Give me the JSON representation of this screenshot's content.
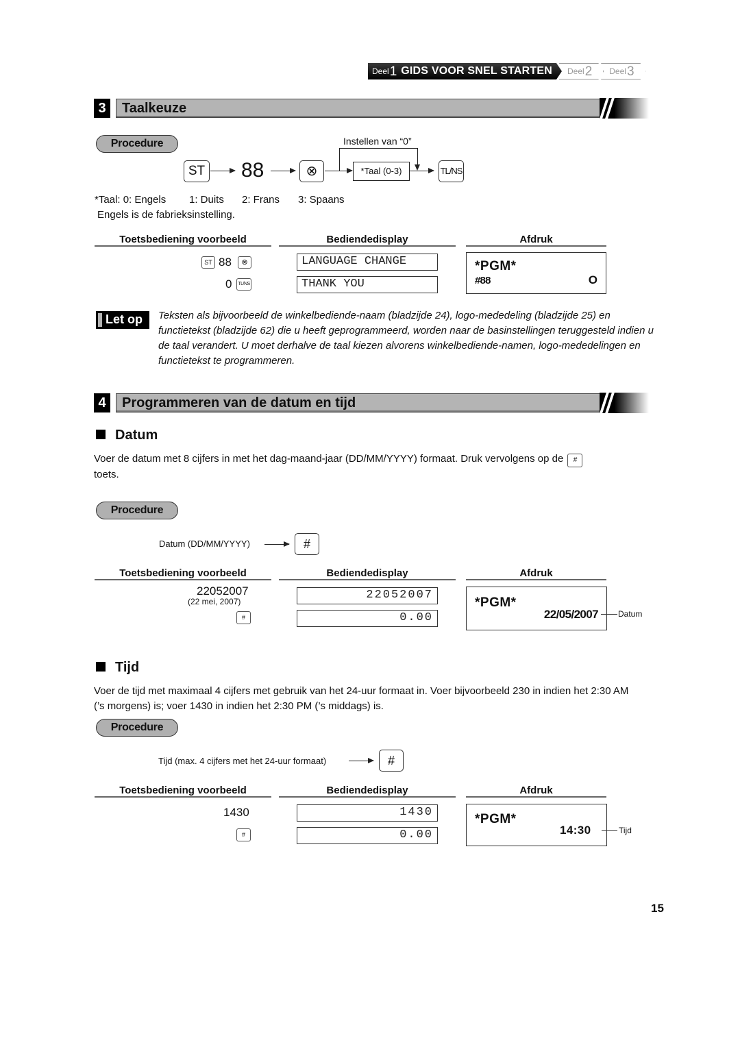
{
  "breadcrumb": {
    "active": {
      "prefix": "Deel",
      "number": "1",
      "title": "GIDS VOOR SNEL STARTEN"
    },
    "items": [
      {
        "prefix": "Deel",
        "number": "2"
      },
      {
        "prefix": "Deel",
        "number": "3"
      }
    ]
  },
  "section3": {
    "number": "3",
    "title": "Taalkeuze",
    "procedure_label": "Procedure",
    "flow": {
      "key_st": "ST",
      "code": "88",
      "key_multiply": "⊗",
      "bypass_label": "Instellen van “0”",
      "taal_box": "*Taal (0-3)",
      "key_tlns": "TL/NS"
    },
    "language_options": [
      "*Taal: 0: Engels",
      "1: Duits",
      "2: Frans",
      "3: Spaans"
    ],
    "default_note": "Engels is de fabrieksinstelling.",
    "columns": {
      "keys": "Toetsbediening voorbeeld",
      "display": "Bediendedisplay",
      "print": "Afdruk"
    },
    "example": {
      "key_row1": {
        "key_st": "ST",
        "code": "88",
        "key_multiply": "⊗"
      },
      "key_row2": {
        "value": "0",
        "key_tlns": "TL/NS"
      },
      "display_row1": "LANGUAGE CHANGE",
      "display_row2": "THANK YOU",
      "print_header": "*PGM*",
      "print_line_left": "#88",
      "print_line_right": "O"
    },
    "note_badge": "Let op",
    "note_text": "Teksten als bijvoorbeeld de winkelbediende-naam (bladzijde 24), logo-mededeling (bladzijde 25) en functietekst (bladzijde 62) die u heeft geprogrammeerd, worden naar de basinstellingen teruggesteld indien u de taal verandert. U moet derhalve de taal kiezen alvorens winkelbediende-namen, logo-mededelingen en functietekst te programmeren."
  },
  "section4": {
    "number": "4",
    "title": "Programmeren van de datum en tijd",
    "datum": {
      "heading": "Datum",
      "description_before": "Voer de datum met 8 cijfers in met het dag-maand-jaar (DD/MM/YYYY) formaat. Druk vervolgens op de",
      "description_key": "#",
      "description_after": "toets.",
      "procedure_label": "Procedure",
      "flow_label": "Datum (DD/MM/YYYY)",
      "flow_key": "#",
      "columns": {
        "keys": "Toetsbediening voorbeeld",
        "display": "Bediendedisplay",
        "print": "Afdruk"
      },
      "example": {
        "key_value": "22052007",
        "key_note": "(22 mei, 2007)",
        "key_hash": "#",
        "display_row1": "22052007",
        "display_row2": "0.00",
        "print_header": "*PGM*",
        "print_value": "22/05/2007",
        "print_callout": "Datum"
      }
    },
    "tijd": {
      "heading": "Tijd",
      "description": "Voer de tijd met maximaal 4 cijfers met gebruik van het 24-uur formaat in. Voer bijvoorbeeld 230 in indien het 2:30 AM (’s morgens) is; voer 1430 in indien het 2:30 PM (’s middags) is.",
      "procedure_label": "Procedure",
      "flow_label": "Tijd (max. 4 cijfers met het 24-uur formaat)",
      "flow_key": "#",
      "columns": {
        "keys": "Toetsbediening voorbeeld",
        "display": "Bediendedisplay",
        "print": "Afdruk"
      },
      "example": {
        "key_value": "1430",
        "key_hash": "#",
        "display_row1": "1430",
        "display_row2": "0.00",
        "print_header": "*PGM*",
        "print_value": "14:30",
        "print_callout": "Tijd"
      }
    }
  },
  "page_number": "15"
}
